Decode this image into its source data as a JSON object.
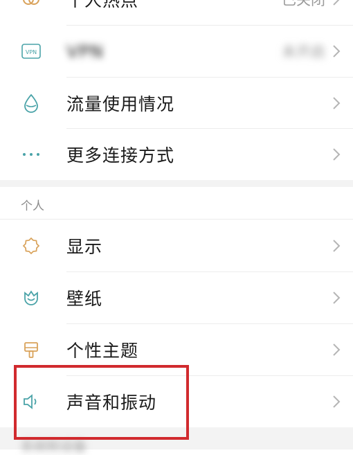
{
  "rows": [
    {
      "key": "hotspot",
      "label": "个人热点",
      "value": "已关闭",
      "icon": "hotspot-icon"
    },
    {
      "key": "vpn",
      "label": "VPN",
      "value": "未开启",
      "icon": "vpn-icon",
      "icon_text": "VPN"
    },
    {
      "key": "data_usage",
      "label": "流量使用情况",
      "icon": "water-drop-icon"
    },
    {
      "key": "more_connections",
      "label": "更多连接方式",
      "icon": "more-dots-icon"
    },
    {
      "key": "display",
      "label": "显示",
      "icon": "sun-icon"
    },
    {
      "key": "wallpaper",
      "label": "壁纸",
      "icon": "tulip-icon"
    },
    {
      "key": "theme",
      "label": "个性主题",
      "icon": "brush-icon"
    },
    {
      "key": "sound",
      "label": "声音和振动",
      "icon": "speaker-icon"
    }
  ],
  "section": {
    "personal": "个人"
  },
  "footer_partial": "系统和设备",
  "colors": {
    "accent": "#4aa3a8",
    "display_icon": "#d9a25a",
    "highlight_border": "#d12a2e",
    "chevron": "#b5b5b5"
  }
}
